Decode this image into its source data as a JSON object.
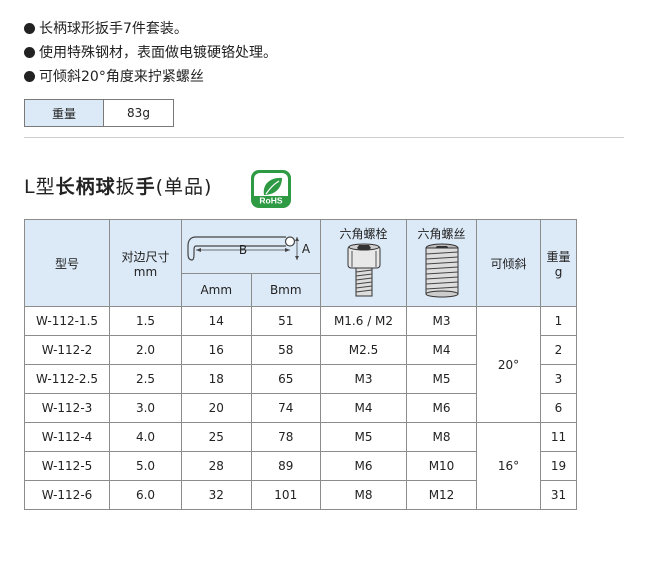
{
  "features": [
    "长柄球形扳手7件套装。",
    "使用特殊钢材，表面做电镀硬铬处理。",
    "可倾斜20°角度来拧紧螺丝"
  ],
  "weight": {
    "label": "重量",
    "value": "83g"
  },
  "title": {
    "prefix": "L型",
    "bold1": "长柄球",
    "mid": "扳",
    "bold2": "手",
    "suffix": "(单品)"
  },
  "rohs": {
    "text": "RoHS"
  },
  "colors": {
    "header_bg": "#dce9f7",
    "rohs_green": "#2e9a44",
    "border": "#8c8c8c"
  },
  "table": {
    "headers": {
      "model": "型号",
      "size": "对边尺寸",
      "size_unit": "mm",
      "a": "Amm",
      "b": "Bmm",
      "drawing_b": "B",
      "drawing_a": "A",
      "bolt": "六角螺栓",
      "screw": "六角螺丝",
      "tilt": "可倾斜",
      "weight": "重量",
      "weight_unit": "g"
    },
    "rows": [
      {
        "model": "W-112-1.5",
        "size": "1.5",
        "a": "14",
        "b": "51",
        "bolt": "M1.6 / M2",
        "screw": "M3",
        "weight": "1"
      },
      {
        "model": "W-112-2",
        "size": "2.0",
        "a": "16",
        "b": "58",
        "bolt": "M2.5",
        "screw": "M4",
        "weight": "2"
      },
      {
        "model": "W-112-2.5",
        "size": "2.5",
        "a": "18",
        "b": "65",
        "bolt": "M3",
        "screw": "M5",
        "weight": "3"
      },
      {
        "model": "W-112-3",
        "size": "3.0",
        "a": "20",
        "b": "74",
        "bolt": "M4",
        "screw": "M6",
        "weight": "6"
      },
      {
        "model": "W-112-4",
        "size": "4.0",
        "a": "25",
        "b": "78",
        "bolt": "M5",
        "screw": "M8",
        "weight": "11"
      },
      {
        "model": "W-112-5",
        "size": "5.0",
        "a": "28",
        "b": "89",
        "bolt": "M6",
        "screw": "M10",
        "weight": "19"
      },
      {
        "model": "W-112-6",
        "size": "6.0",
        "a": "32",
        "b": "101",
        "bolt": "M8",
        "screw": "M12",
        "weight": "31"
      }
    ],
    "tilt_groups": [
      "20°",
      "16°"
    ]
  }
}
